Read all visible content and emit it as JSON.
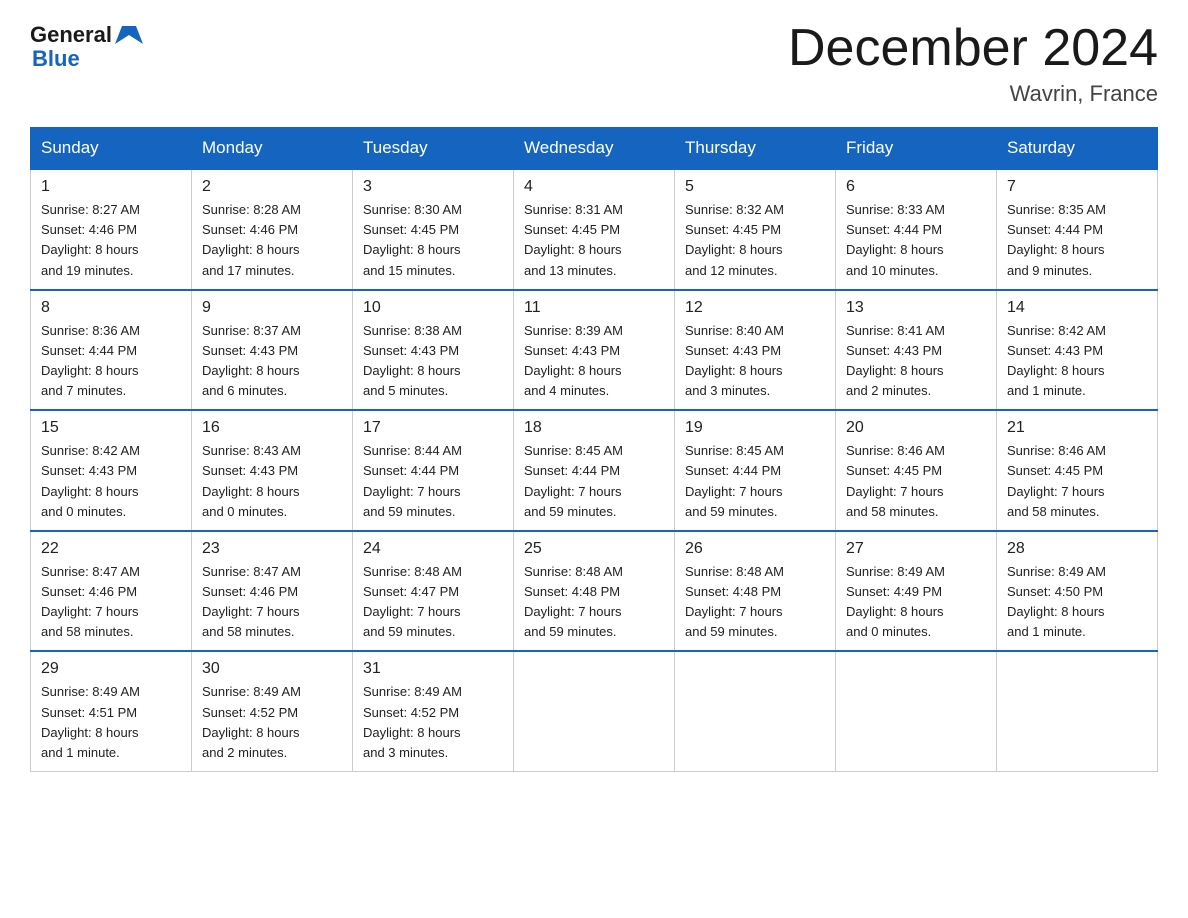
{
  "header": {
    "logo_general": "General",
    "logo_blue": "Blue",
    "month_title": "December 2024",
    "location": "Wavrin, France"
  },
  "days_of_week": [
    "Sunday",
    "Monday",
    "Tuesday",
    "Wednesday",
    "Thursday",
    "Friday",
    "Saturday"
  ],
  "weeks": [
    [
      {
        "day": "1",
        "sunrise": "8:27 AM",
        "sunset": "4:46 PM",
        "daylight": "8 hours and 19 minutes."
      },
      {
        "day": "2",
        "sunrise": "8:28 AM",
        "sunset": "4:46 PM",
        "daylight": "8 hours and 17 minutes."
      },
      {
        "day": "3",
        "sunrise": "8:30 AM",
        "sunset": "4:45 PM",
        "daylight": "8 hours and 15 minutes."
      },
      {
        "day": "4",
        "sunrise": "8:31 AM",
        "sunset": "4:45 PM",
        "daylight": "8 hours and 13 minutes."
      },
      {
        "day": "5",
        "sunrise": "8:32 AM",
        "sunset": "4:45 PM",
        "daylight": "8 hours and 12 minutes."
      },
      {
        "day": "6",
        "sunrise": "8:33 AM",
        "sunset": "4:44 PM",
        "daylight": "8 hours and 10 minutes."
      },
      {
        "day": "7",
        "sunrise": "8:35 AM",
        "sunset": "4:44 PM",
        "daylight": "8 hours and 9 minutes."
      }
    ],
    [
      {
        "day": "8",
        "sunrise": "8:36 AM",
        "sunset": "4:44 PM",
        "daylight": "8 hours and 7 minutes."
      },
      {
        "day": "9",
        "sunrise": "8:37 AM",
        "sunset": "4:43 PM",
        "daylight": "8 hours and 6 minutes."
      },
      {
        "day": "10",
        "sunrise": "8:38 AM",
        "sunset": "4:43 PM",
        "daylight": "8 hours and 5 minutes."
      },
      {
        "day": "11",
        "sunrise": "8:39 AM",
        "sunset": "4:43 PM",
        "daylight": "8 hours and 4 minutes."
      },
      {
        "day": "12",
        "sunrise": "8:40 AM",
        "sunset": "4:43 PM",
        "daylight": "8 hours and 3 minutes."
      },
      {
        "day": "13",
        "sunrise": "8:41 AM",
        "sunset": "4:43 PM",
        "daylight": "8 hours and 2 minutes."
      },
      {
        "day": "14",
        "sunrise": "8:42 AM",
        "sunset": "4:43 PM",
        "daylight": "8 hours and 1 minute."
      }
    ],
    [
      {
        "day": "15",
        "sunrise": "8:42 AM",
        "sunset": "4:43 PM",
        "daylight": "8 hours and 0 minutes."
      },
      {
        "day": "16",
        "sunrise": "8:43 AM",
        "sunset": "4:43 PM",
        "daylight": "8 hours and 0 minutes."
      },
      {
        "day": "17",
        "sunrise": "8:44 AM",
        "sunset": "4:44 PM",
        "daylight": "7 hours and 59 minutes."
      },
      {
        "day": "18",
        "sunrise": "8:45 AM",
        "sunset": "4:44 PM",
        "daylight": "7 hours and 59 minutes."
      },
      {
        "day": "19",
        "sunrise": "8:45 AM",
        "sunset": "4:44 PM",
        "daylight": "7 hours and 59 minutes."
      },
      {
        "day": "20",
        "sunrise": "8:46 AM",
        "sunset": "4:45 PM",
        "daylight": "7 hours and 58 minutes."
      },
      {
        "day": "21",
        "sunrise": "8:46 AM",
        "sunset": "4:45 PM",
        "daylight": "7 hours and 58 minutes."
      }
    ],
    [
      {
        "day": "22",
        "sunrise": "8:47 AM",
        "sunset": "4:46 PM",
        "daylight": "7 hours and 58 minutes."
      },
      {
        "day": "23",
        "sunrise": "8:47 AM",
        "sunset": "4:46 PM",
        "daylight": "7 hours and 58 minutes."
      },
      {
        "day": "24",
        "sunrise": "8:48 AM",
        "sunset": "4:47 PM",
        "daylight": "7 hours and 59 minutes."
      },
      {
        "day": "25",
        "sunrise": "8:48 AM",
        "sunset": "4:48 PM",
        "daylight": "7 hours and 59 minutes."
      },
      {
        "day": "26",
        "sunrise": "8:48 AM",
        "sunset": "4:48 PM",
        "daylight": "7 hours and 59 minutes."
      },
      {
        "day": "27",
        "sunrise": "8:49 AM",
        "sunset": "4:49 PM",
        "daylight": "8 hours and 0 minutes."
      },
      {
        "day": "28",
        "sunrise": "8:49 AM",
        "sunset": "4:50 PM",
        "daylight": "8 hours and 1 minute."
      }
    ],
    [
      {
        "day": "29",
        "sunrise": "8:49 AM",
        "sunset": "4:51 PM",
        "daylight": "8 hours and 1 minute."
      },
      {
        "day": "30",
        "sunrise": "8:49 AM",
        "sunset": "4:52 PM",
        "daylight": "8 hours and 2 minutes."
      },
      {
        "day": "31",
        "sunrise": "8:49 AM",
        "sunset": "4:52 PM",
        "daylight": "8 hours and 3 minutes."
      },
      null,
      null,
      null,
      null
    ]
  ],
  "labels": {
    "sunrise": "Sunrise:",
    "sunset": "Sunset:",
    "daylight": "Daylight:"
  }
}
